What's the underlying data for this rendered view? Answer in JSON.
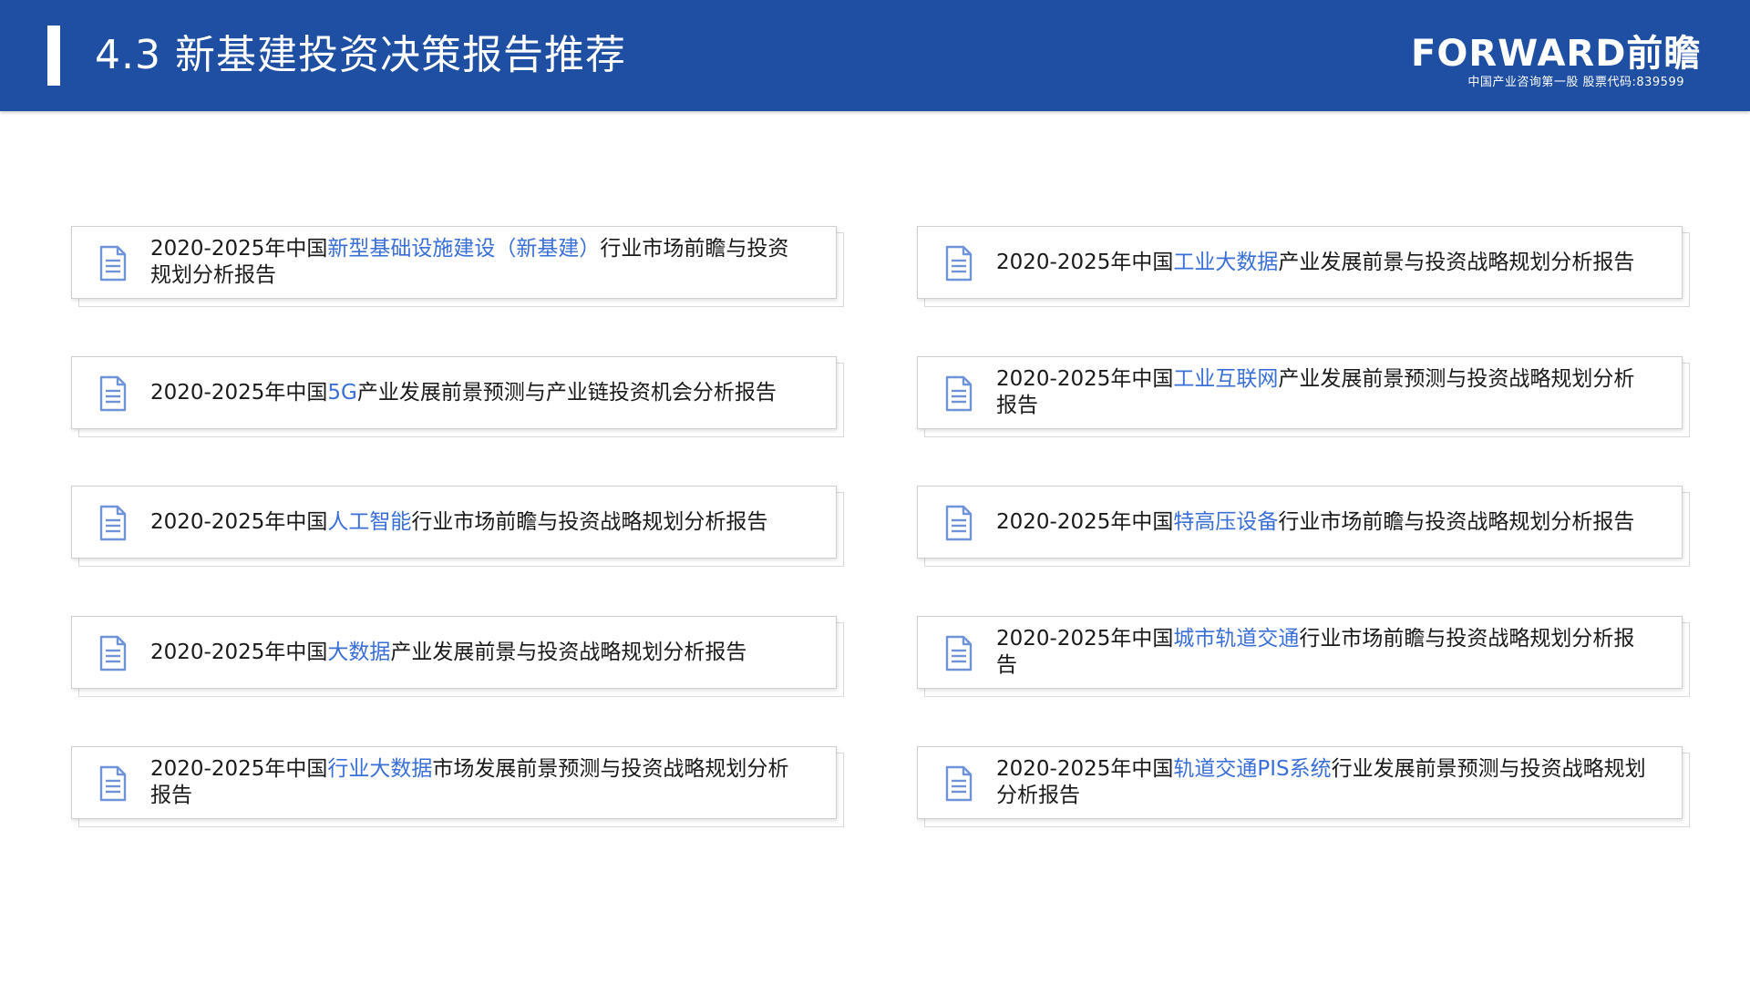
{
  "header": {
    "title": "4.3 新基建投资决策报告推荐",
    "logo": {
      "wordmark": "FORWARD前瞻",
      "tagline": "中国产业咨询第一股  股票代码:839599"
    }
  },
  "colors": {
    "header_bg": "#1f4fa3",
    "highlight": "#3a6fd8",
    "text": "#1a1a1a",
    "icon": "#6f93d8"
  },
  "icons": {
    "card_icon": "document-icon"
  },
  "reports": [
    {
      "prefix": "2020-2025年中国",
      "highlight": "新型基础设施建设（新基建）",
      "suffix": "行业市场前瞻与投资规划分析报告"
    },
    {
      "prefix": "2020-2025年中国",
      "highlight": "工业大数据",
      "suffix": "产业发展前景与投资战略规划分析报告"
    },
    {
      "prefix": "2020-2025年中国",
      "highlight": "5G",
      "suffix": "产业发展前景预测与产业链投资机会分析报告"
    },
    {
      "prefix": "2020-2025年中国",
      "highlight": "工业互联网",
      "suffix": "产业发展前景预测与投资战略规划分析报告"
    },
    {
      "prefix": "2020-2025年中国",
      "highlight": "人工智能",
      "suffix": "行业市场前瞻与投资战略规划分析报告"
    },
    {
      "prefix": "2020-2025年中国",
      "highlight": "特高压设备",
      "suffix": "行业市场前瞻与投资战略规划分析报告"
    },
    {
      "prefix": "2020-2025年中国",
      "highlight": "大数据",
      "suffix": "产业发展前景与投资战略规划分析报告"
    },
    {
      "prefix": "2020-2025年中国",
      "highlight": "城市轨道交通",
      "suffix": "行业市场前瞻与投资战略规划分析报告"
    },
    {
      "prefix": "2020-2025年中国",
      "highlight": "行业大数据",
      "suffix": "市场发展前景预测与投资战略规划分析报告"
    },
    {
      "prefix": "2020-2025年中国",
      "highlight": "轨道交通PIS系统",
      "suffix": "行业发展前景预测与投资战略规划分析报告"
    }
  ]
}
